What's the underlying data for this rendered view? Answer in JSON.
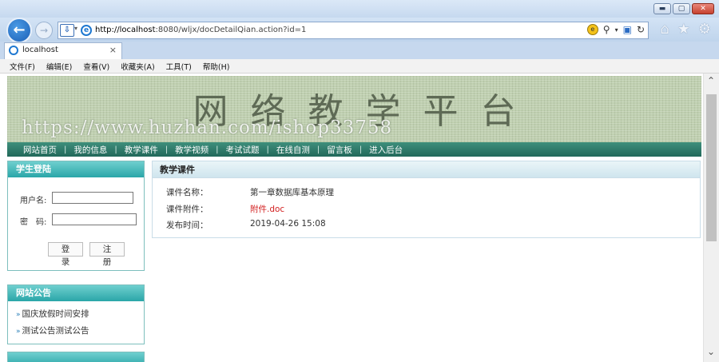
{
  "browser": {
    "window_buttons": {
      "minimize": "▬",
      "maximize": "▢",
      "close": "✕"
    },
    "url_host": "http://localhost",
    "url_rest": ":8080/wljx/docDetailQian.action?id=1",
    "tab_title": "localhost",
    "tab_close": "×",
    "menu": [
      "文件(F)",
      "编辑(E)",
      "查看(V)",
      "收藏夹(A)",
      "工具(T)",
      "帮助(H)"
    ]
  },
  "site": {
    "title": "网络教学平台",
    "watermark": "https://www.huzhan.com/ishop33758",
    "nav": [
      "网站首页",
      "我的信息",
      "教学课件",
      "教学视频",
      "考试试题",
      "在线自测",
      "留言板",
      "进入后台"
    ]
  },
  "login": {
    "heading": "学生登陆",
    "username_label": "用户名:",
    "password_label": "密　码:",
    "login_button": "登 录",
    "register_button": "注 册"
  },
  "notice": {
    "heading": "网站公告",
    "items": [
      "国庆放假时间安排",
      "测试公告测试公告"
    ]
  },
  "courseware": {
    "heading": "教学课件",
    "rows": [
      {
        "label": "课件名称：",
        "value": "第一章数据库基本原理"
      },
      {
        "label": "课件附件：",
        "value": "附件.doc"
      },
      {
        "label": "发布时间：",
        "value": "2019-04-26 15:08"
      }
    ]
  }
}
